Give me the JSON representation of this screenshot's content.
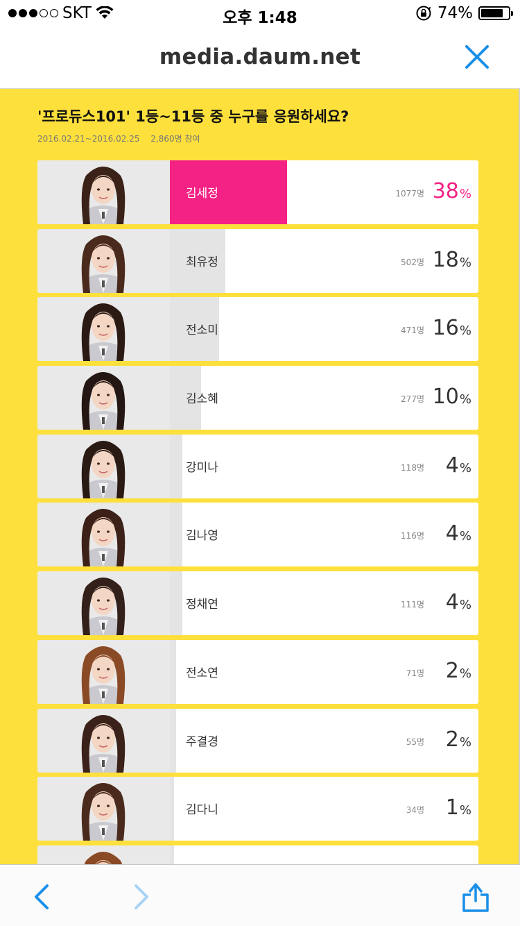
{
  "status_bar": {
    "carrier": "SKT",
    "time": "오후 1:48",
    "battery": "74%",
    "battery_level": 0.74,
    "signal_bars_filled": 3,
    "signal_bars_total": 5
  },
  "url_bar": {
    "url": "media.daum.net"
  },
  "poll": {
    "title": "'프로듀스101' 1등~11등 중 누구를 응원하세요?",
    "period": "2016.02.21~2016.02.25",
    "participants": "2,860명 참여",
    "accent_color": "#f42285",
    "background_color": "#fee03c",
    "candidates": [
      {
        "name": "김세정",
        "votes": "1077명",
        "percent": "38",
        "unit": "%",
        "share": 0.38,
        "hair": "#3a2218"
      },
      {
        "name": "최유정",
        "votes": "502명",
        "percent": "18",
        "unit": "%",
        "share": 0.18,
        "hair": "#4a2a1c"
      },
      {
        "name": "전소미",
        "votes": "471명",
        "percent": "16",
        "unit": "%",
        "share": 0.16,
        "hair": "#2b1a14"
      },
      {
        "name": "김소혜",
        "votes": "277명",
        "percent": "10",
        "unit": "%",
        "share": 0.1,
        "hair": "#241612"
      },
      {
        "name": "강미나",
        "votes": "118명",
        "percent": "4",
        "unit": "%",
        "share": 0.04,
        "hair": "#2a1a14"
      },
      {
        "name": "김나영",
        "votes": "116명",
        "percent": "4",
        "unit": "%",
        "share": 0.04,
        "hair": "#3b2118"
      },
      {
        "name": "정채연",
        "votes": "111명",
        "percent": "4",
        "unit": "%",
        "share": 0.04,
        "hair": "#33201a"
      },
      {
        "name": "전소연",
        "votes": "71명",
        "percent": "2",
        "unit": "%",
        "share": 0.02,
        "hair": "#8a4a25"
      },
      {
        "name": "주결경",
        "votes": "55명",
        "percent": "2",
        "unit": "%",
        "share": 0.02,
        "hair": "#3a2119"
      },
      {
        "name": "김다니",
        "votes": "34명",
        "percent": "1",
        "unit": "%",
        "share": 0.01,
        "hair": "#4a2a1c"
      },
      {
        "name": "",
        "votes": "",
        "percent": "",
        "unit": "",
        "share": 0.01,
        "hair": "#8a4a25"
      }
    ]
  },
  "toolbar": {
    "back_icon": "chevron-left-icon",
    "forward_icon": "chevron-right-icon",
    "share_icon": "share-icon",
    "active_color": "#1a8fe8",
    "disabled_color": "#a9d3f5"
  }
}
